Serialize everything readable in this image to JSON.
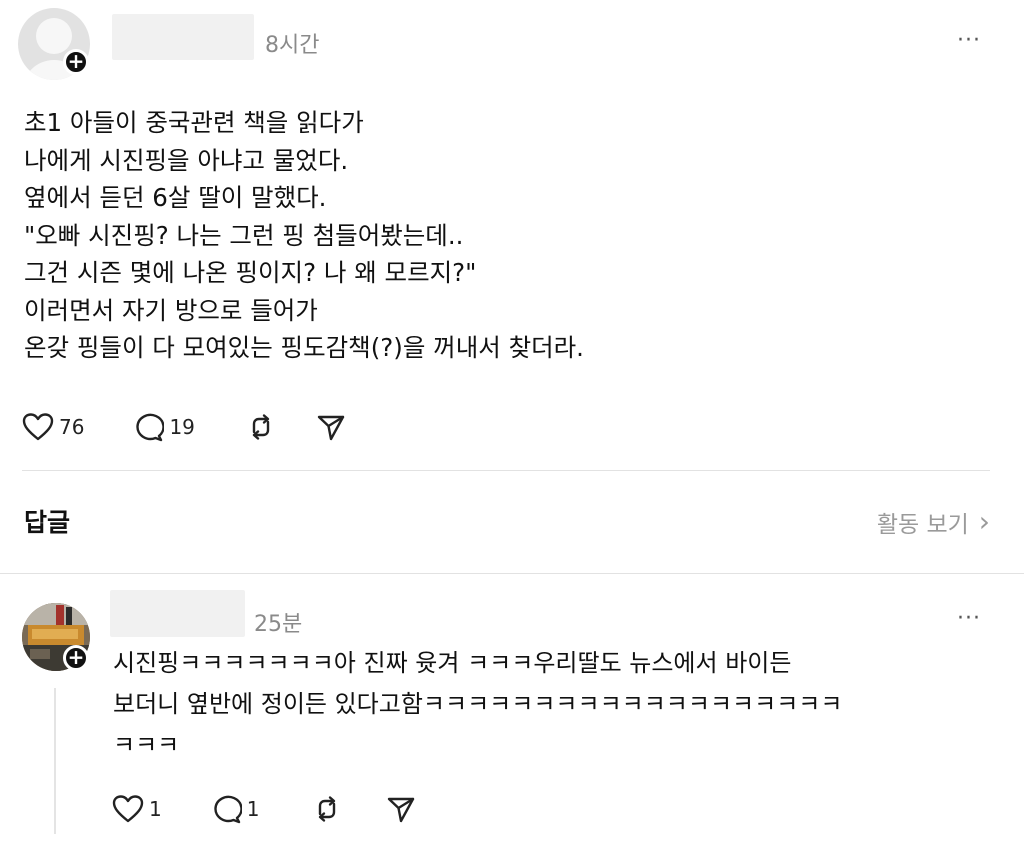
{
  "post": {
    "time": "8시간",
    "more": "···",
    "lines": [
      "초1 아들이 중국관련 책을 읽다가",
      "나에게 시진핑을 아냐고 물었다.",
      "옆에서 듣던 6살 딸이 말했다.",
      "\"오빠 시진핑? 나는 그런 핑 첨들어봤는데..",
      "그건 시즌 몇에 나온 핑이지? 나 왜 모르지?\"",
      "이러면서 자기 방으로 들어가",
      "온갖 핑들이 다 모여있는 핑도감책(?)을 꺼내서 찾더라."
    ],
    "likes": "76",
    "comments": "19",
    "icons": [
      "heart-icon",
      "comment-icon",
      "repost-icon",
      "share-icon"
    ]
  },
  "replies_section": {
    "label": "답글",
    "activity_link": "활동 보기",
    "chevron": "›"
  },
  "comment": {
    "time": "25분",
    "more": "···",
    "lines": [
      "시진핑ㅋㅋㅋㅋㅋㅋㅋ아 진짜 윳겨 ㅋㅋㅋ우리딸도 뉴스에서 바이든",
      "보더니 옆반에 정이든 있다고함ㅋㅋㅋㅋㅋㅋㅋㅋㅋㅋㅋㅋㅋㅋㅋㅋㅋㅋㅋ",
      "ㅋㅋㅋ"
    ],
    "likes": "1",
    "comments": "1"
  }
}
